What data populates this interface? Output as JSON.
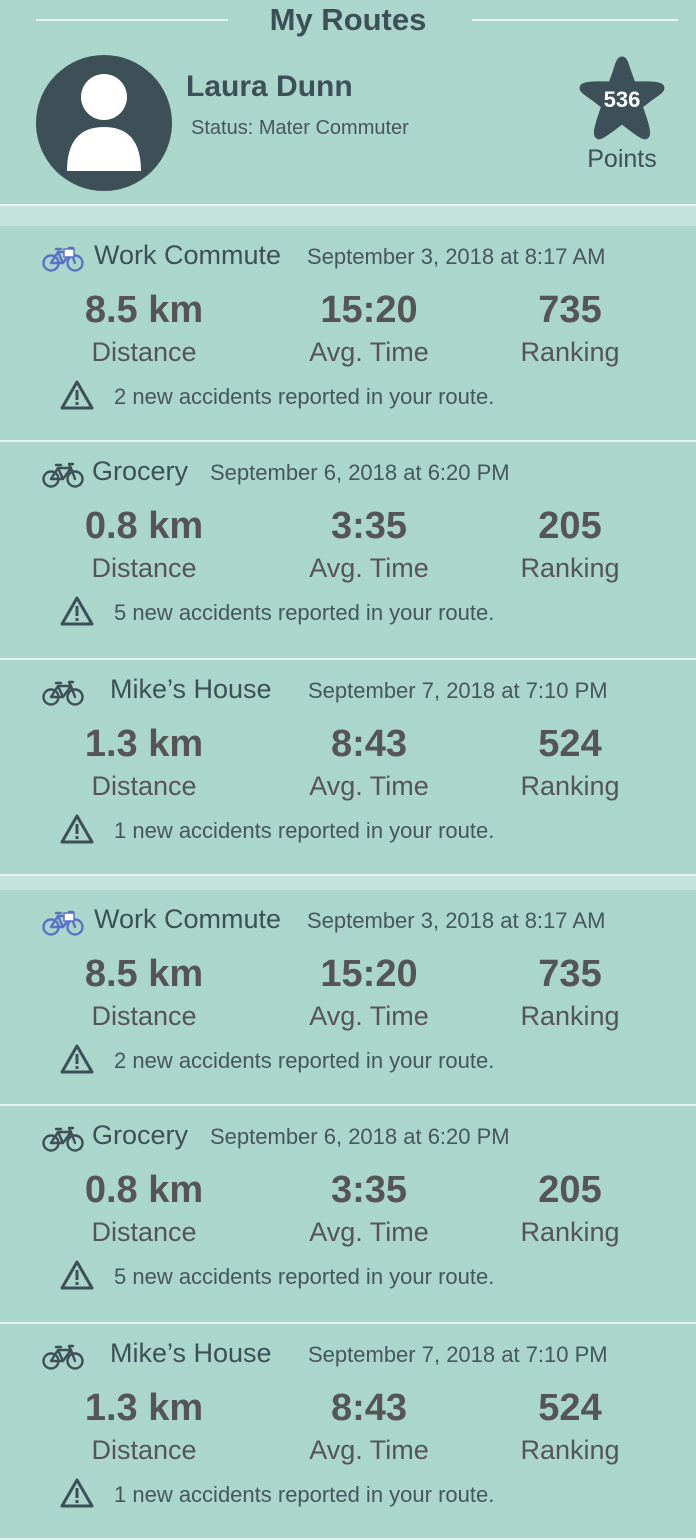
{
  "header": {
    "title": "My Routes",
    "user_name": "Laura Dunn",
    "status": "Status: Mater Commuter",
    "points_value": "536",
    "points_label": "Points"
  },
  "colors": {
    "background": "#abd6cc",
    "dark": "#3d4f57",
    "icon_blue": "#5b72c4"
  },
  "routes": [
    {
      "icon": "bike-with-box-icon",
      "name": "Work Commute",
      "date": "September 3, 2018 at 8:17 AM",
      "distance": "8.5 km",
      "distance_label": "Distance",
      "time": "15:20",
      "time_label": "Avg. Time",
      "ranking": "735",
      "ranking_label": "Ranking",
      "alert": "2 new accidents reported in your route."
    },
    {
      "icon": "bike-icon",
      "name": "Grocery",
      "date": "September 6, 2018 at 6:20 PM",
      "distance": "0.8 km",
      "distance_label": "Distance",
      "time": "3:35",
      "time_label": "Avg. Time",
      "ranking": "205",
      "ranking_label": "Ranking",
      "alert": "5 new accidents reported in your route."
    },
    {
      "icon": "bike-icon",
      "name": "Mike’s House",
      "date": "September 7, 2018 at 7:10 PM",
      "distance": "1.3 km",
      "distance_label": "Distance",
      "time": "8:43",
      "time_label": "Avg. Time",
      "ranking": "524",
      "ranking_label": "Ranking",
      "alert": "1 new accidents reported in your route."
    },
    {
      "icon": "bike-with-box-icon",
      "name": "Work Commute",
      "date": "September 3, 2018 at 8:17 AM",
      "distance": "8.5 km",
      "distance_label": "Distance",
      "time": "15:20",
      "time_label": "Avg. Time",
      "ranking": "735",
      "ranking_label": "Ranking",
      "alert": "2 new accidents reported in your route."
    },
    {
      "icon": "bike-icon",
      "name": "Grocery",
      "date": "September 6, 2018 at 6:20 PM",
      "distance": "0.8 km",
      "distance_label": "Distance",
      "time": "3:35",
      "time_label": "Avg. Time",
      "ranking": "205",
      "ranking_label": "Ranking",
      "alert": "5 new accidents reported in your route."
    },
    {
      "icon": "bike-icon",
      "name": "Mike’s House",
      "date": "September 7, 2018 at 7:10 PM",
      "distance": "1.3 km",
      "distance_label": "Distance",
      "time": "8:43",
      "time_label": "Avg. Time",
      "ranking": "524",
      "ranking_label": "Ranking",
      "alert": "1 new accidents reported in your route."
    }
  ]
}
